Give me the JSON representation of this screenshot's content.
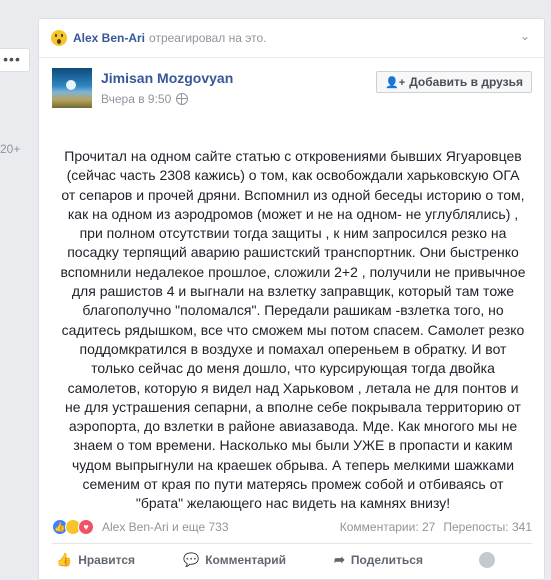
{
  "left": {
    "dots": "•••",
    "count": "20+"
  },
  "story": {
    "actor": "Alex Ben-Ari",
    "action": "отреагировал на это.",
    "chevron": "⌄"
  },
  "post": {
    "author": "Jimisan Mozgovyan",
    "time": "Вчера в 9:50",
    "add_friend_label": "Добавить в друзья",
    "text_lines": [
      "Прочитал на одном сайте статью с откровениями бывших Ягуаровцев",
      "(сейчас часть 2308 кажись) о том, как освобождали харьковскую ОГА",
      "от сепаров и прочей дряни. Вспомнил из одной беседы историю о том,",
      "как на одном из аэродромов (может и не на одном- не углублялись) ,",
      "при полном отсутствии тогда защиты , к ним запросился резко на",
      "посадку терпящий аварию рашистский транспортник. Они быстренко",
      "вспомнили недалекое прошлое, сложили 2+2 , получили не привычное",
      "для рашистов 4 и выгнали на взлетку заправщик, который там тоже",
      "благополучно \"поломался\". Передали рашикам -взлетка того, но",
      "садитесь рядышком, все что сможем мы потом спасем. Самолет резко",
      "поддомкратился в воздухе и помахал опереньем в обратку. И вот",
      "только сейчас до меня дошло, что курсирующая тогда двойка",
      "самолетов, которую я видел над Харьковом , летала не для понтов и",
      "не для устрашения сепарни, а вполне себе покрывала территорию от",
      "аэропорта, до взлетки в районе авиазавода. Мде. Как многого мы не",
      "знаем о том времени. Насколько мы были УЖЕ в пропасти и каким",
      "чудом выпрыгнули на краешек обрыва. А теперь мелкими шажками",
      "семеним от края по пути матерясь промеж собой и отбиваясь от",
      "\"брата\" желающего нас видеть на камнях внизу!"
    ]
  },
  "reactions": {
    "summary": "Alex Ben-Ari и еще 733",
    "comments": "Комментарии: 27",
    "shares": "Перепосты: 341"
  },
  "actions": {
    "like": "Нравится",
    "comment": "Комментарий",
    "share": "Поделиться"
  },
  "colors": {
    "link": "#365899",
    "like_blue": "#4080ff",
    "wow_yellow": "#f7c52a",
    "love_red": "#f25268"
  }
}
